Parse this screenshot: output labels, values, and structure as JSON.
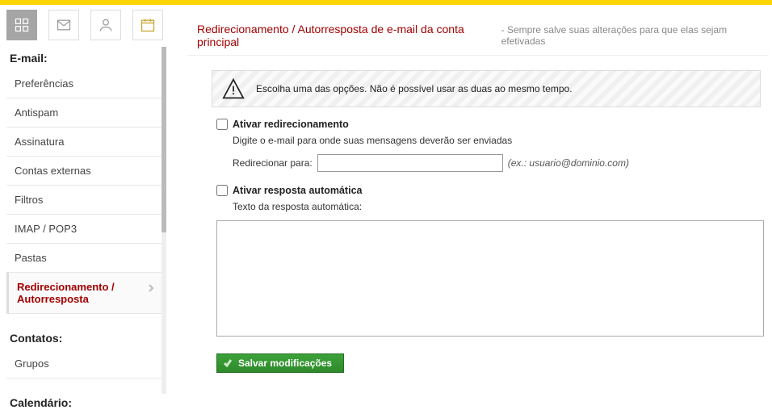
{
  "toolbar": {
    "btn_grid": "grid-icon",
    "btn_mail": "mail-icon",
    "btn_person": "person-icon",
    "btn_calendar": "calendar-icon"
  },
  "sidebar": {
    "section_email": "E-mail:",
    "items": [
      {
        "label": "Preferências"
      },
      {
        "label": "Antispam"
      },
      {
        "label": "Assinatura"
      },
      {
        "label": "Contas externas"
      },
      {
        "label": "Filtros"
      },
      {
        "label": "IMAP / POP3"
      },
      {
        "label": "Pastas"
      },
      {
        "label": "Redirecionamento / Autorresposta"
      }
    ],
    "section_contacts": "Contatos:",
    "contacts_items": [
      {
        "label": "Grupos"
      }
    ],
    "section_calendar": "Calendário:"
  },
  "page": {
    "title_main": "Redirecionamento / Autorresposta de e-mail da conta principal",
    "title_sub": "- Sempre salve suas alterações para que elas sejam efetivadas"
  },
  "notice": {
    "text": "Escolha uma das opções. Não é possível usar as duas ao mesmo tempo."
  },
  "redirect": {
    "checkbox_label": "Ativar redirecionamento",
    "desc": "Digite o e-mail para onde suas mensagens deverão ser enviadas",
    "field_label": "Redirecionar para:",
    "value": "",
    "hint": "(ex.: usuario@dominio.com)"
  },
  "autoreply": {
    "checkbox_label": "Ativar resposta automática",
    "desc": "Texto da resposta automática:",
    "value": ""
  },
  "buttons": {
    "save": "Salvar modificações"
  }
}
